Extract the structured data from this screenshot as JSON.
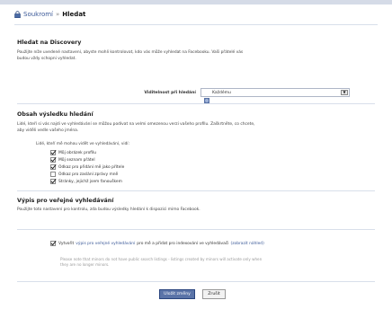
{
  "breadcrumb": {
    "parent": "Soukromí",
    "separator": "»",
    "current": "Hledat"
  },
  "discovery": {
    "title": "Hledat na Discovery",
    "description_line1": "Použijte níže uvedené nastavení, abyste mohli kontrolovat, kdo vás může vyhledat na Facebooku. Vaši přátelé vás",
    "description_line2": "budou vždy schopni vyhledat."
  },
  "visibility": {
    "label": "Viditelnost při hledání",
    "selected": "Každému",
    "icon": "globe-icon"
  },
  "results": {
    "title": "Obsah výsledku hledání",
    "description_line1": "Lidé, kteří si vás najdi ve vyhledávání se můžou podívat na velmi omezenou verzi vašeho profilu. Zaškrtněte, co chcete,",
    "description_line2": "aby viděli vedle vašeho jména.",
    "sub_label": "Lidé, kteří mě mohou vidět ve vyhledávání, vidí:",
    "options": [
      {
        "label": "Můj obrázek profilu",
        "checked": true
      },
      {
        "label": "Můj seznam přátel",
        "checked": true
      },
      {
        "label": "Odkaz pro přidání mě jako přítele",
        "checked": true
      },
      {
        "label": "Odkaz pro zaslání zprávy mně",
        "checked": false
      },
      {
        "label": "Stránky, jejichž jsem fanouškem",
        "checked": true
      }
    ]
  },
  "public": {
    "title": "Výpis pro veřejné vyhledávání",
    "description": "Použijte toto nastavení pro kontrolu, zda budou výsledky hledání k dispozici mimo Facebook.",
    "create_prefix": "Vytvořit",
    "create_link": "výpis pro veřejné vyhledávání",
    "create_middle": "pro mě a přidat pro indexování ve vyhledávači",
    "preview_link": "(zobrazit náhled)",
    "checked": true,
    "note_line1": "Please note that minors do not have public search listings - listings created by minors will activate only when",
    "note_line2": "they are no longer minors."
  },
  "buttons": {
    "save": "Uložit změny",
    "cancel": "Zrušit"
  },
  "colors": {
    "link": "#3b5998",
    "primary_button": "#5b74a8",
    "divider": "#d8dfea"
  }
}
